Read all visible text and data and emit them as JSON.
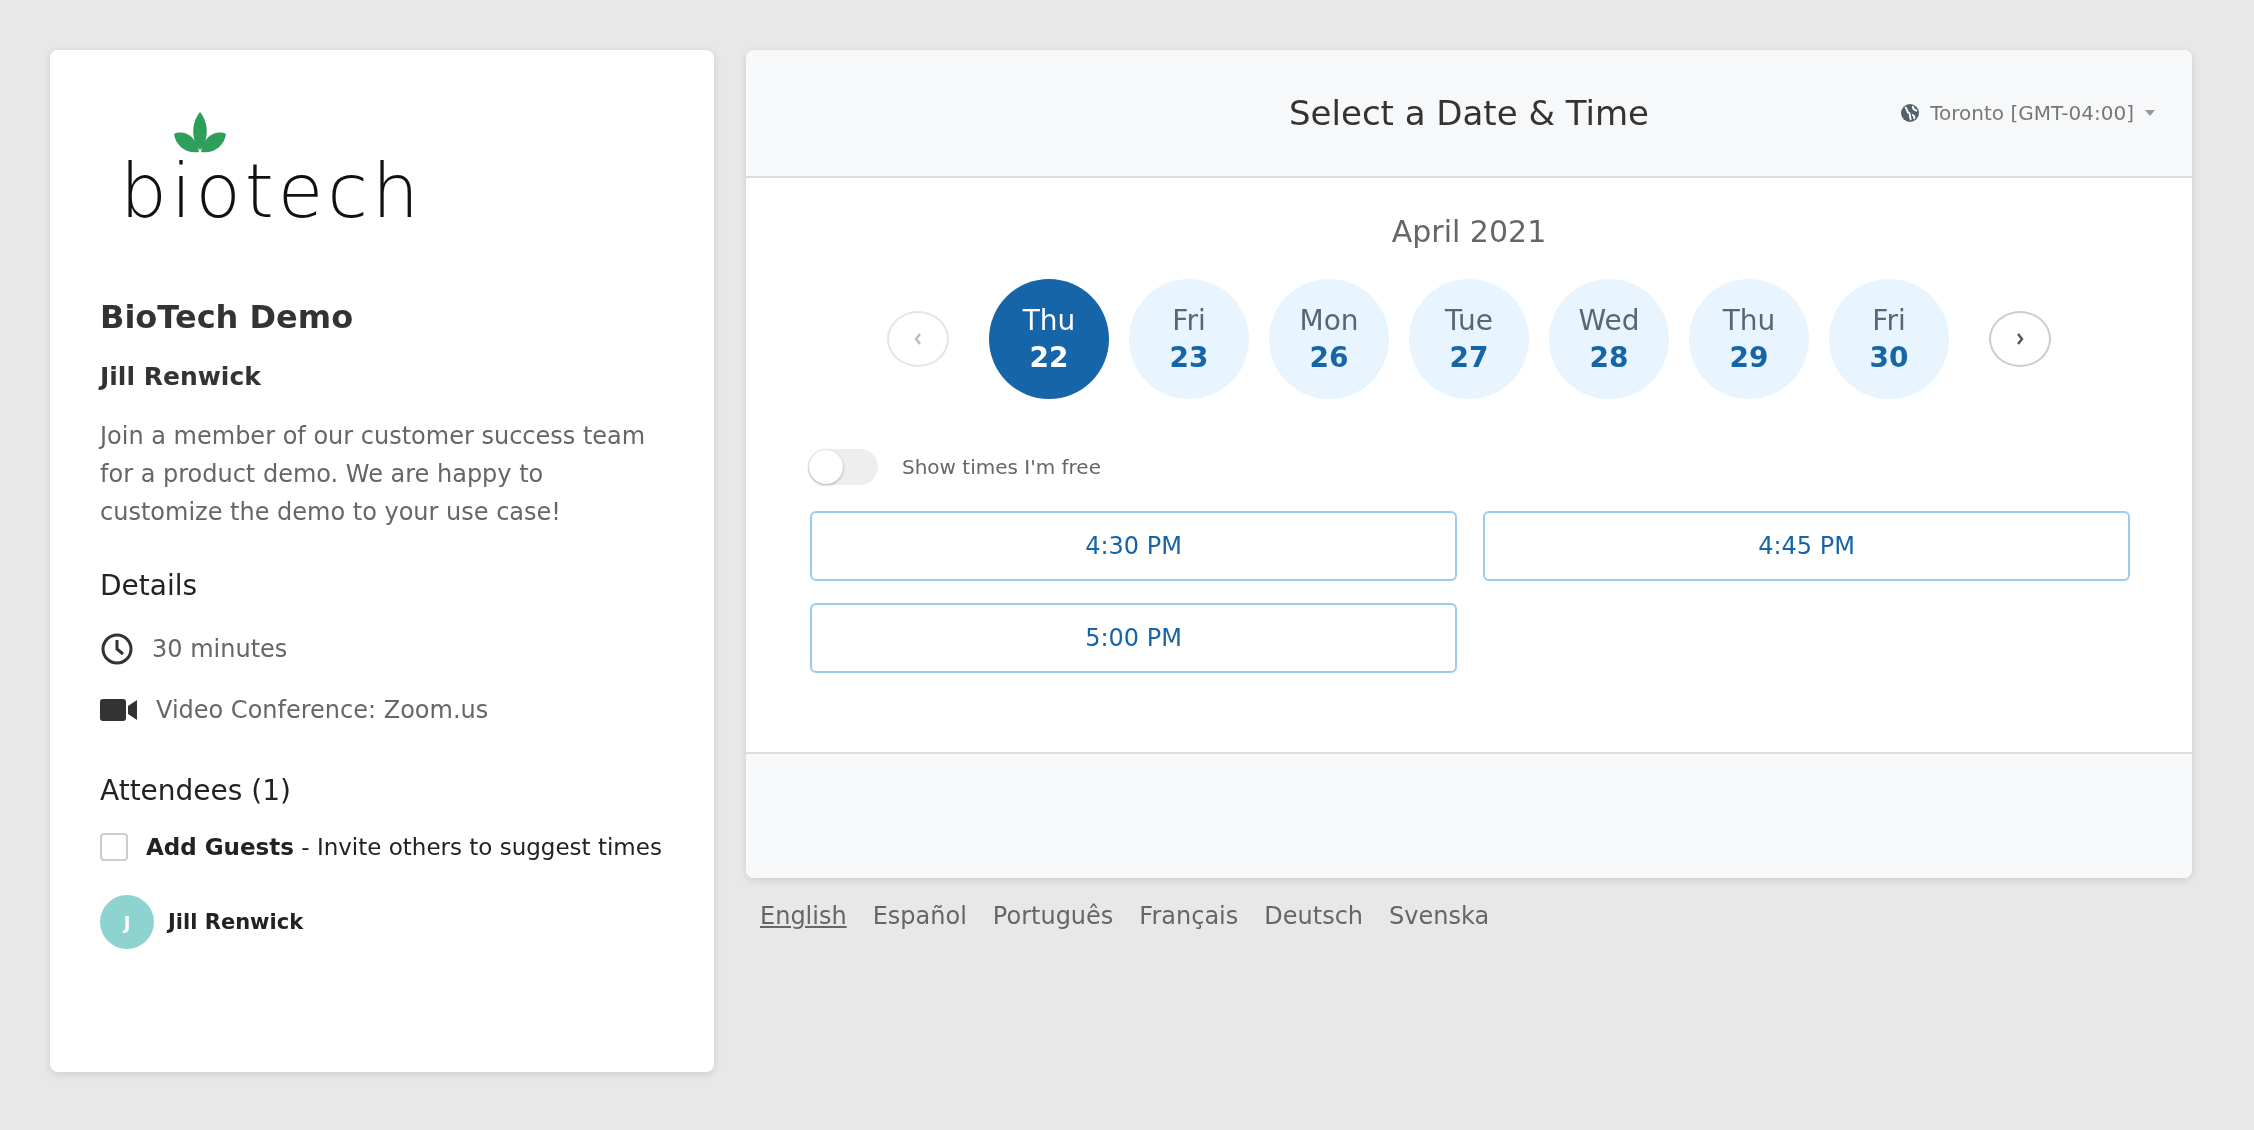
{
  "event": {
    "logo_text": "biotech",
    "title": "BioTech Demo",
    "host": "Jill Renwick",
    "description": "Join a member of our customer success team for a product demo. We are happy to customize the demo to your use case!",
    "details_heading": "Details",
    "details": [
      {
        "kind": "duration",
        "text": "30 minutes"
      },
      {
        "kind": "video",
        "text": "Video Conference: Zoom.us"
      }
    ],
    "attendees_heading": "Attendees (1)",
    "add_guests": {
      "checked": false,
      "label": "**Add Guests** - Invite others to suggest times"
    },
    "attendees": [
      {
        "initial": "J",
        "name": "Jill Renwick",
        "color": "#8dd3d0"
      }
    ]
  },
  "scheduler": {
    "title": "Select a Date & Time",
    "timezone": "Toronto [GMT-04:00]",
    "month": "April 2021",
    "dates": [
      {
        "weekday": "Thu",
        "day": "22",
        "selected": true
      },
      {
        "weekday": "Fri",
        "day": "23",
        "selected": false
      },
      {
        "weekday": "Mon",
        "day": "26",
        "selected": false
      },
      {
        "weekday": "Tue",
        "day": "27",
        "selected": false
      },
      {
        "weekday": "Wed",
        "day": "28",
        "selected": false
      },
      {
        "weekday": "Thu",
        "day": "29",
        "selected": false
      },
      {
        "weekday": "Fri",
        "day": "30",
        "selected": false
      }
    ],
    "free_toggle": {
      "on": false,
      "label": "Show times I'm free"
    },
    "times": [
      "4:30 PM",
      "4:45 PM",
      "5:00 PM"
    ]
  },
  "languages": [
    {
      "label": "English",
      "selected": true
    },
    {
      "label": "Español",
      "selected": false
    },
    {
      "label": "Português",
      "selected": false
    },
    {
      "label": "Français",
      "selected": false
    },
    {
      "label": "Deutsch",
      "selected": false
    },
    {
      "label": "Svenska",
      "selected": false
    }
  ]
}
